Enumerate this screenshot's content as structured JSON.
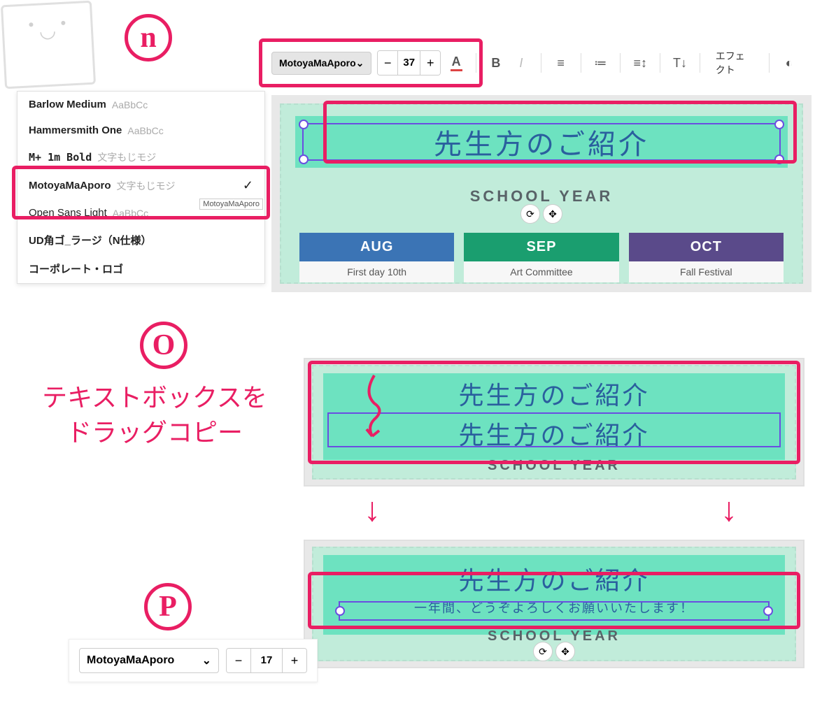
{
  "steps": {
    "n": "n",
    "o": "O",
    "p": "P"
  },
  "toolbar_n": {
    "font_name": "MotoyaMaAporo",
    "font_size": "37",
    "effects_label": "エフェクト"
  },
  "font_list": [
    {
      "name": "Barlow Medium",
      "sample": "AaBbCc"
    },
    {
      "name": "Hammersmith One",
      "sample": "AaBbCc"
    },
    {
      "name": "M+ 1m Bold",
      "sample": "文字もじモジ"
    },
    {
      "name": "MotoyaMaAporo",
      "sample": "文字もじモジ",
      "selected": true
    },
    {
      "name": "Open Sans Light",
      "sample": "AaBbCc"
    },
    {
      "name": "UD角ゴ_ラージ（N仕様）",
      "sample": ""
    },
    {
      "name": "コーポレート・ロゴ",
      "sample": ""
    }
  ],
  "tooltip_n": "MotoyaMaAporo",
  "design": {
    "title": "先生方のご紹介",
    "subtitle": "SCHOOL YEAR",
    "months": [
      {
        "label": "AUG",
        "sub": "First day 10th"
      },
      {
        "label": "SEP",
        "sub": "Art Committee"
      },
      {
        "label": "OCT",
        "sub": "Fall Festival"
      }
    ]
  },
  "annotation_o": {
    "line1": "テキストボックスを",
    "line2": "ドラッグコピー"
  },
  "design_o2": {
    "title": "先生方のご紹介",
    "body": "一年間、どうぞよろしくお願いいたします！"
  },
  "toolbar_p": {
    "font_name": "MotoyaMaAporo",
    "font_size": "17"
  }
}
